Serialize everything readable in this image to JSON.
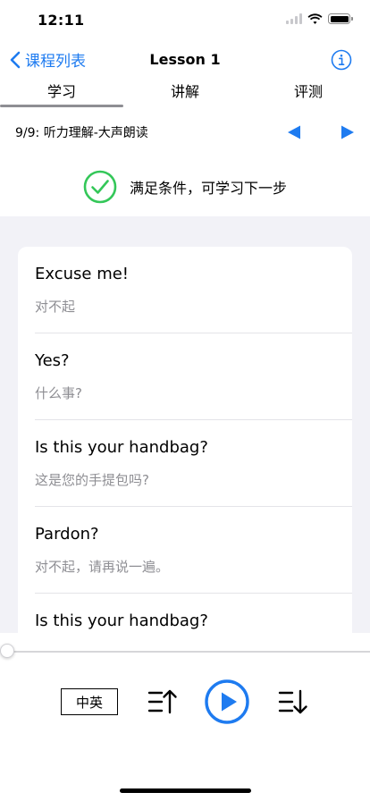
{
  "status_bar": {
    "time": "12:11"
  },
  "nav": {
    "back_label": "课程列表",
    "title": "Lesson 1"
  },
  "tabs": [
    {
      "label": "学习",
      "selected": true
    },
    {
      "label": "讲解",
      "selected": false
    },
    {
      "label": "评测",
      "selected": false
    }
  ],
  "lesson": {
    "label": "9/9:   听力理解-大声朗读"
  },
  "condition": {
    "text": "满足条件，可学习下一步",
    "color": "#34c759"
  },
  "sentences": [
    {
      "en": "Excuse me!",
      "zh": "对不起"
    },
    {
      "en": "Yes?",
      "zh": "什么事?"
    },
    {
      "en": "Is this your handbag?",
      "zh": "这是您的手提包吗?"
    },
    {
      "en": "Pardon?",
      "zh": "对不起，请再说一遍。"
    },
    {
      "en": "Is this your handbag?",
      "zh": ""
    }
  ],
  "player": {
    "lang_label": "中英",
    "progress": 0
  },
  "colors": {
    "accent": "#1e7bf0"
  }
}
